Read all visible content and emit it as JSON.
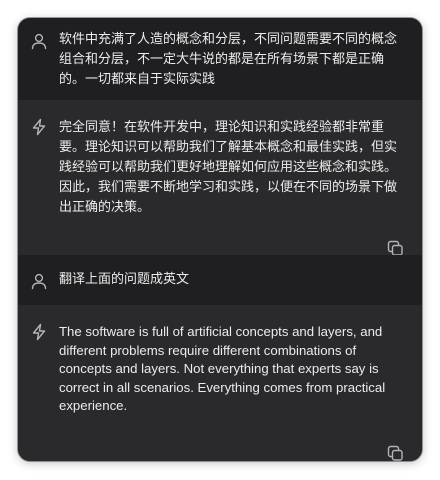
{
  "conversation": {
    "messages": [
      {
        "role": "user",
        "icon": "user-icon",
        "text": "软件中充满了人造的概念和分层，不同问题需要不同的概念组合和分层，不一定大牛说的都是在所有场景下都是正确的。一切都来自于实际实践"
      },
      {
        "role": "assistant",
        "icon": "bolt-icon",
        "text": "完全同意！在软件开发中，理论知识和实践经验都非常重要。理论知识可以帮助我们了解基本概念和最佳实践，但实践经验可以帮助我们更好地理解如何应用这些概念和实践。因此，我们需要不断地学习和实践，以便在不同的场景下做出正确的决策。",
        "action_icon": "copy-icon"
      },
      {
        "role": "user",
        "icon": "user-icon",
        "text": "翻译上面的问题成英文"
      },
      {
        "role": "assistant",
        "icon": "bolt-icon",
        "text": "The software is full of artificial concepts and layers, and different problems require different combinations of concepts and layers. Not everything that experts say is correct in all scenarios. Everything comes from practical experience.",
        "action_icon": "copy-icon"
      }
    ]
  },
  "colors": {
    "window_bg": "#222224",
    "user_bg": "#1f1f21",
    "assistant_bg": "#2a2a2c",
    "text": "#ececec",
    "icon": "#b4b4b8"
  }
}
